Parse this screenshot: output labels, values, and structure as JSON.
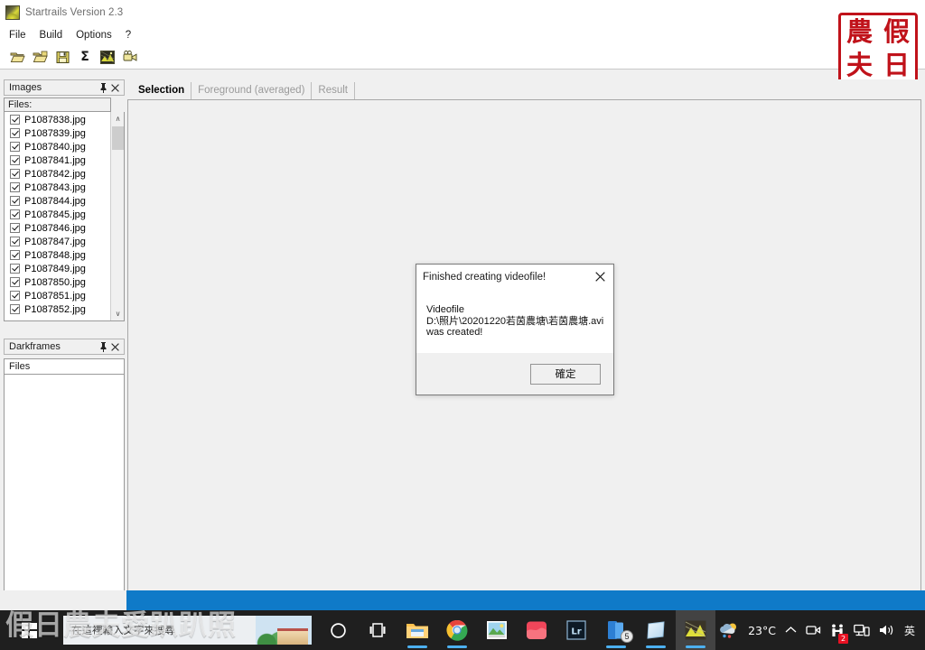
{
  "window": {
    "title": "Startrails Version 2.3",
    "icon": "startrails-app-icon"
  },
  "menubar": {
    "items": [
      {
        "label": "File",
        "name": "menu-file"
      },
      {
        "label": "Build",
        "name": "menu-build"
      },
      {
        "label": "Options",
        "name": "menu-options"
      },
      {
        "label": "?",
        "name": "menu-help"
      }
    ]
  },
  "toolbar": {
    "buttons": [
      {
        "name": "open-images-icon",
        "title": "Open images"
      },
      {
        "name": "open-darkframes-icon",
        "title": "Open darkframes"
      },
      {
        "name": "save-icon",
        "title": "Save"
      },
      {
        "name": "sigma-icon",
        "glyph": "Σ",
        "title": "Sum / Startrails"
      },
      {
        "name": "startrails-icon",
        "title": "Build startrails"
      },
      {
        "name": "video-camera-icon",
        "title": "Create video"
      }
    ]
  },
  "images_panel": {
    "title": "Images",
    "pin_icon": "pin-icon",
    "close_icon": "close-icon",
    "files_label": "Files:",
    "files": [
      "P1087838.jpg",
      "P1087839.jpg",
      "P1087840.jpg",
      "P1087841.jpg",
      "P1087842.jpg",
      "P1087843.jpg",
      "P1087844.jpg",
      "P1087845.jpg",
      "P1087846.jpg",
      "P1087847.jpg",
      "P1087848.jpg",
      "P1087849.jpg",
      "P1087850.jpg",
      "P1087851.jpg",
      "P1087852.jpg"
    ],
    "scroll_up": "∧",
    "scroll_down": "∨"
  },
  "darkframes_panel": {
    "title": "Darkframes",
    "pin_icon": "pin-icon",
    "close_icon": "close-icon",
    "files_label": "Files",
    "files": []
  },
  "tabs": [
    {
      "label": "Selection",
      "active": true
    },
    {
      "label": "Foreground (averaged)",
      "active": false
    },
    {
      "label": "Result",
      "active": false
    }
  ],
  "dialog": {
    "title": "Finished creating videofile!",
    "close_icon": "close-icon",
    "message": "Videofile\nD:\\照片\\20201220若茵農塘\\若茵農塘.avi\nwas created!",
    "ok_label": "確定"
  },
  "seal": {
    "chars": [
      "農",
      "假",
      "夫",
      "日"
    ],
    "color": "#c0121a"
  },
  "watermark": {
    "text": "假日農夫愛趴趴照"
  },
  "taskbar": {
    "start_icon": "windows-start-icon",
    "search_placeholder": "在這裡輸入文字來搜尋",
    "cortana_icon": "cortana-circle-icon",
    "taskview_icon": "task-view-icon",
    "apps": [
      {
        "name": "file-explorer-icon",
        "label": "File Explorer",
        "running": true
      },
      {
        "name": "google-chrome-icon",
        "label": "Google Chrome",
        "running": true
      },
      {
        "name": "photos-icon",
        "label": "Photos",
        "running": false
      },
      {
        "name": "app-red-icon",
        "label": "Red app",
        "running": false
      },
      {
        "name": "lightroom-icon",
        "label": "Lr",
        "running": false
      },
      {
        "name": "app-blue-stack-icon",
        "label": "Blue app",
        "running": true,
        "badge": "5"
      },
      {
        "name": "sticky-notes-icon",
        "label": "Notes",
        "running": true
      },
      {
        "name": "startrails-taskbar-icon",
        "label": "Startrails",
        "running": true,
        "active": true
      }
    ],
    "tray": {
      "weather_icon": "weather-rain-icon",
      "temperature": "23°C",
      "chevron_icon": "chevron-up-icon",
      "camera_icon": "camera-icon",
      "updates_icon": "updates-icon",
      "updates_badge": "2",
      "network_icon": "network-icon",
      "volume_icon": "volume-icon",
      "ime_label": "英"
    }
  }
}
